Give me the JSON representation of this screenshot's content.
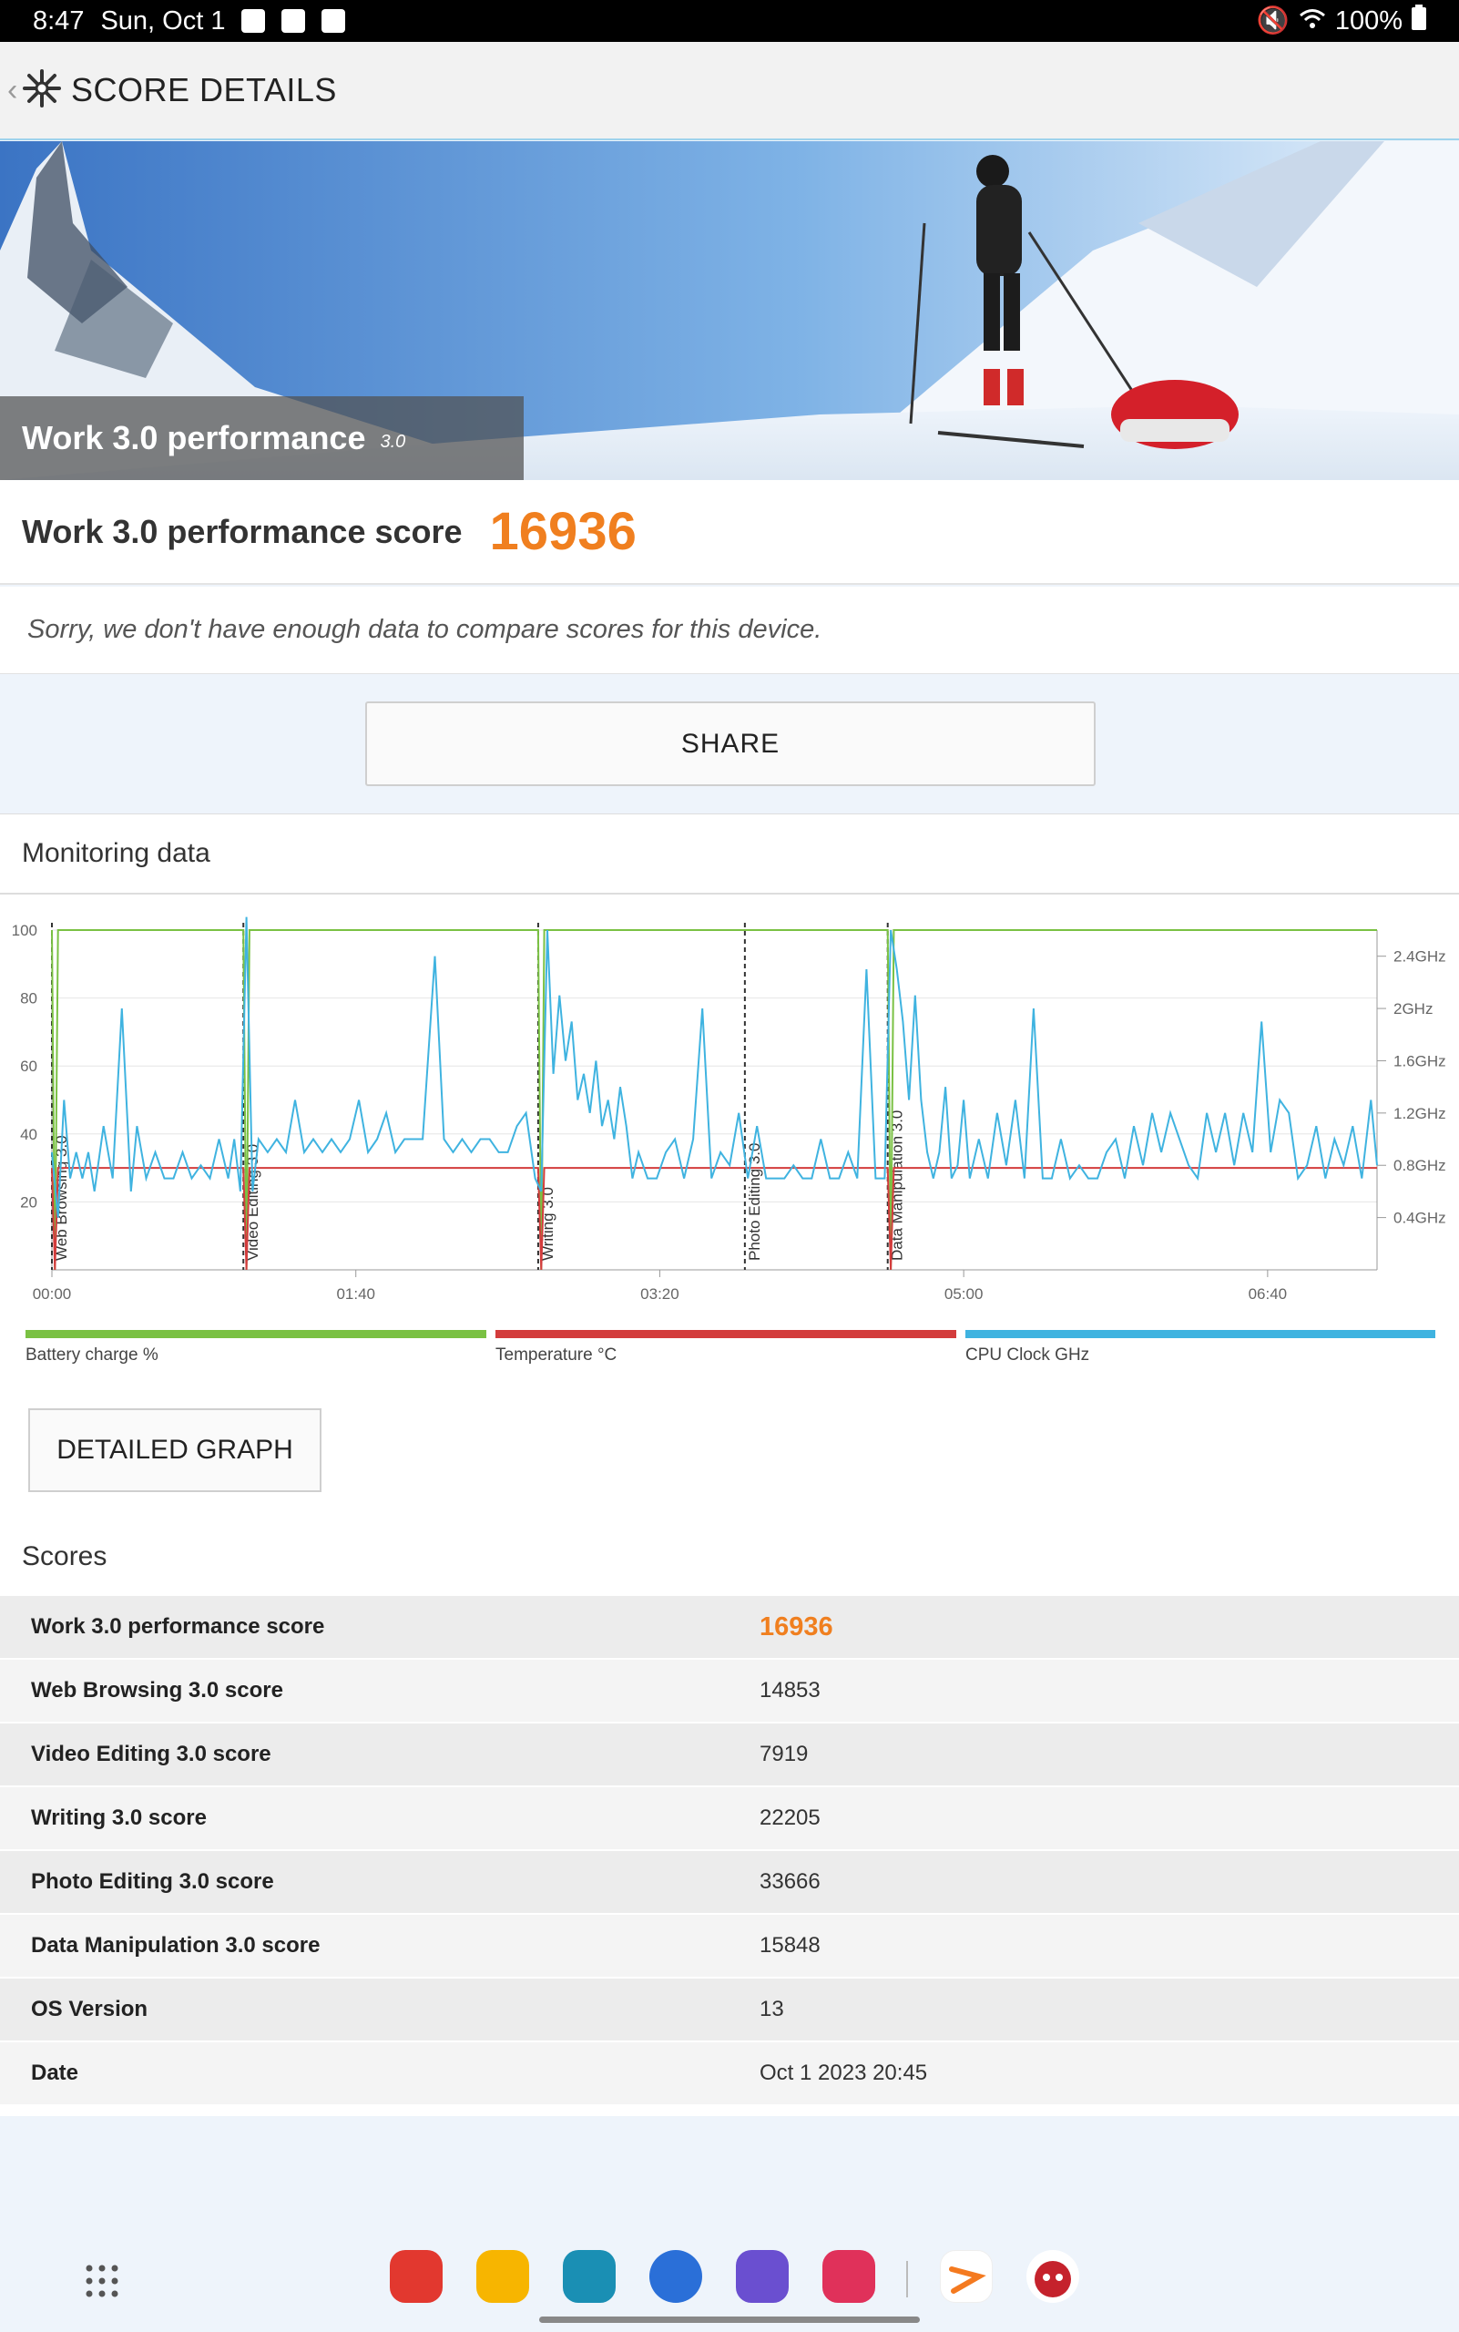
{
  "status_bar": {
    "time": "8:47",
    "date": "Sun, Oct 1",
    "battery": "100%"
  },
  "header": {
    "title": "SCORE DETAILS"
  },
  "hero": {
    "title": "Work 3.0 performance",
    "version": "3.0"
  },
  "score_card": {
    "label": "Work 3.0 performance score",
    "value": "16936"
  },
  "compare_note": "Sorry, we don't have enough data to compare scores for this device.",
  "share_label": "SHARE",
  "monitoring": {
    "title": "Monitoring data",
    "legend": [
      {
        "label": "Battery charge %",
        "color": "#7ac143"
      },
      {
        "label": "Temperature °C",
        "color": "#d33c3c"
      },
      {
        "label": "CPU Clock GHz",
        "color": "#3fb3e0"
      }
    ],
    "detailed_graph_label": "DETAILED GRAPH"
  },
  "chart_data": {
    "type": "line",
    "x_ticks": [
      "00:00",
      "01:40",
      "03:20",
      "05:00",
      "06:40"
    ],
    "y_left_ticks": [
      "20",
      "40",
      "60",
      "80",
      "100"
    ],
    "y_right_ticks": [
      "0.4GHz",
      "0.8GHz",
      "1.2GHz",
      "1.6GHz",
      "2GHz",
      "2.4GHz"
    ],
    "xlim_seconds": [
      0,
      436
    ],
    "ylim_left": [
      0,
      100
    ],
    "ylim_right_ghz": [
      0,
      2.6
    ],
    "sections": [
      {
        "label": "Web Browsing 3.0",
        "start": 0
      },
      {
        "label": "Video Editing 3.0",
        "start": 63
      },
      {
        "label": "Writing 3.0",
        "start": 160
      },
      {
        "label": "Photo Editing 3.0",
        "start": 228
      },
      {
        "label": "Data Manipulation 3.0",
        "start": 275
      }
    ],
    "series": [
      {
        "name": "Battery charge %",
        "points": [
          [
            0,
            100
          ],
          [
            1,
            0
          ],
          [
            2,
            100
          ],
          [
            63,
            100
          ],
          [
            64,
            0
          ],
          [
            65,
            100
          ],
          [
            160,
            100
          ],
          [
            161,
            0
          ],
          [
            162,
            100
          ],
          [
            275,
            100
          ],
          [
            276,
            0
          ],
          [
            277,
            100
          ],
          [
            436,
            100
          ]
        ]
      },
      {
        "name": "Temperature °C",
        "points": [
          [
            0,
            30
          ],
          [
            1,
            0
          ],
          [
            2,
            30
          ],
          [
            63,
            30
          ],
          [
            64,
            0
          ],
          [
            65,
            30
          ],
          [
            160,
            30
          ],
          [
            161,
            0
          ],
          [
            162,
            30
          ],
          [
            275,
            30
          ],
          [
            276,
            0
          ],
          [
            277,
            30
          ],
          [
            436,
            30
          ]
        ]
      },
      {
        "name": "CPU Clock GHz",
        "points": [
          [
            0,
            0.9
          ],
          [
            2,
            0.4
          ],
          [
            4,
            1.3
          ],
          [
            6,
            0.7
          ],
          [
            8,
            0.9
          ],
          [
            10,
            0.7
          ],
          [
            12,
            0.9
          ],
          [
            14,
            0.6
          ],
          [
            17,
            1.1
          ],
          [
            20,
            0.7
          ],
          [
            23,
            2.0
          ],
          [
            26,
            0.6
          ],
          [
            28,
            1.1
          ],
          [
            31,
            0.7
          ],
          [
            34,
            0.9
          ],
          [
            37,
            0.7
          ],
          [
            40,
            0.7
          ],
          [
            43,
            0.9
          ],
          [
            46,
            0.7
          ],
          [
            49,
            0.8
          ],
          [
            52,
            0.7
          ],
          [
            55,
            1.0
          ],
          [
            58,
            0.7
          ],
          [
            60,
            1.0
          ],
          [
            62,
            0.6
          ],
          [
            64,
            2.7
          ],
          [
            66,
            0.6
          ],
          [
            68,
            1.0
          ],
          [
            71,
            0.9
          ],
          [
            74,
            1.0
          ],
          [
            77,
            0.9
          ],
          [
            80,
            1.3
          ],
          [
            83,
            0.9
          ],
          [
            86,
            1.0
          ],
          [
            89,
            0.9
          ],
          [
            92,
            1.0
          ],
          [
            95,
            0.9
          ],
          [
            98,
            1.0
          ],
          [
            101,
            1.3
          ],
          [
            104,
            0.9
          ],
          [
            107,
            1.0
          ],
          [
            110,
            1.2
          ],
          [
            113,
            0.9
          ],
          [
            116,
            1.0
          ],
          [
            119,
            1.0
          ],
          [
            122,
            1.0
          ],
          [
            126,
            2.4
          ],
          [
            129,
            1.0
          ],
          [
            132,
            0.9
          ],
          [
            135,
            1.0
          ],
          [
            138,
            0.9
          ],
          [
            141,
            1.0
          ],
          [
            144,
            1.0
          ],
          [
            147,
            0.9
          ],
          [
            150,
            0.9
          ],
          [
            153,
            1.1
          ],
          [
            156,
            1.2
          ],
          [
            159,
            0.7
          ],
          [
            161,
            0.6
          ],
          [
            163,
            2.6
          ],
          [
            165,
            1.5
          ],
          [
            167,
            2.1
          ],
          [
            169,
            1.6
          ],
          [
            171,
            1.9
          ],
          [
            173,
            1.3
          ],
          [
            175,
            1.5
          ],
          [
            177,
            1.2
          ],
          [
            179,
            1.6
          ],
          [
            181,
            1.1
          ],
          [
            183,
            1.3
          ],
          [
            185,
            1.0
          ],
          [
            187,
            1.4
          ],
          [
            189,
            1.1
          ],
          [
            191,
            0.7
          ],
          [
            193,
            0.9
          ],
          [
            196,
            0.7
          ],
          [
            199,
            0.7
          ],
          [
            202,
            0.9
          ],
          [
            205,
            1.0
          ],
          [
            208,
            0.7
          ],
          [
            211,
            1.0
          ],
          [
            214,
            2.0
          ],
          [
            217,
            0.7
          ],
          [
            220,
            0.9
          ],
          [
            223,
            0.8
          ],
          [
            226,
            1.2
          ],
          [
            229,
            0.7
          ],
          [
            232,
            1.1
          ],
          [
            235,
            0.7
          ],
          [
            238,
            0.7
          ],
          [
            241,
            0.7
          ],
          [
            244,
            0.8
          ],
          [
            247,
            0.7
          ],
          [
            250,
            0.7
          ],
          [
            253,
            1.0
          ],
          [
            256,
            0.7
          ],
          [
            259,
            0.7
          ],
          [
            262,
            0.9
          ],
          [
            265,
            0.7
          ],
          [
            268,
            2.3
          ],
          [
            271,
            0.7
          ],
          [
            274,
            0.7
          ],
          [
            276,
            2.6
          ],
          [
            278,
            2.3
          ],
          [
            280,
            1.9
          ],
          [
            282,
            1.3
          ],
          [
            284,
            2.1
          ],
          [
            286,
            1.3
          ],
          [
            288,
            0.9
          ],
          [
            290,
            0.7
          ],
          [
            292,
            0.9
          ],
          [
            294,
            1.4
          ],
          [
            296,
            0.7
          ],
          [
            298,
            0.8
          ],
          [
            300,
            1.3
          ],
          [
            302,
            0.7
          ],
          [
            305,
            1.0
          ],
          [
            308,
            0.7
          ],
          [
            311,
            1.2
          ],
          [
            314,
            0.8
          ],
          [
            317,
            1.3
          ],
          [
            320,
            0.7
          ],
          [
            323,
            2.0
          ],
          [
            326,
            0.7
          ],
          [
            329,
            0.7
          ],
          [
            332,
            1.0
          ],
          [
            335,
            0.7
          ],
          [
            338,
            0.8
          ],
          [
            341,
            0.7
          ],
          [
            344,
            0.7
          ],
          [
            347,
            0.9
          ],
          [
            350,
            1.0
          ],
          [
            353,
            0.7
          ],
          [
            356,
            1.1
          ],
          [
            359,
            0.8
          ],
          [
            362,
            1.2
          ],
          [
            365,
            0.9
          ],
          [
            368,
            1.2
          ],
          [
            371,
            1.0
          ],
          [
            374,
            0.8
          ],
          [
            377,
            0.7
          ],
          [
            380,
            1.2
          ],
          [
            383,
            0.9
          ],
          [
            386,
            1.2
          ],
          [
            389,
            0.8
          ],
          [
            392,
            1.2
          ],
          [
            395,
            0.9
          ],
          [
            398,
            1.9
          ],
          [
            401,
            0.9
          ],
          [
            404,
            1.3
          ],
          [
            407,
            1.2
          ],
          [
            410,
            0.7
          ],
          [
            413,
            0.8
          ],
          [
            416,
            1.1
          ],
          [
            419,
            0.7
          ],
          [
            422,
            1.0
          ],
          [
            425,
            0.8
          ],
          [
            428,
            1.1
          ],
          [
            431,
            0.7
          ],
          [
            434,
            1.3
          ],
          [
            436,
            0.8
          ]
        ]
      }
    ]
  },
  "scores": {
    "title": "Scores",
    "rows": [
      {
        "label": "Work 3.0 performance score",
        "value": "16936"
      },
      {
        "label": "Web Browsing 3.0 score",
        "value": "14853"
      },
      {
        "label": "Video Editing 3.0 score",
        "value": "7919"
      },
      {
        "label": "Writing 3.0 score",
        "value": "22205"
      },
      {
        "label": "Photo Editing 3.0 score",
        "value": "33666"
      },
      {
        "label": "Data Manipulation 3.0 score",
        "value": "15848"
      },
      {
        "label": "OS Version",
        "value": "13"
      },
      {
        "label": "Date",
        "value": "Oct 1 2023 20:45"
      }
    ]
  },
  "dock": {
    "apps": [
      {
        "icon": "notes-app-icon",
        "color": "#e2382f"
      },
      {
        "icon": "files-app-icon",
        "color": "#f7b500"
      },
      {
        "icon": "calendar-app-icon",
        "color": "#1a8fb4"
      },
      {
        "icon": "messages-app-icon",
        "color": "#2a6fd8"
      },
      {
        "icon": "internet-app-icon",
        "color": "#6a4fd0"
      },
      {
        "icon": "camera-app-icon",
        "color": "#e0315a"
      },
      {
        "icon": "pcmark-app-icon",
        "color": "#f47a20"
      },
      {
        "icon": "antutu-app-icon",
        "color": "#c5222c"
      }
    ]
  }
}
